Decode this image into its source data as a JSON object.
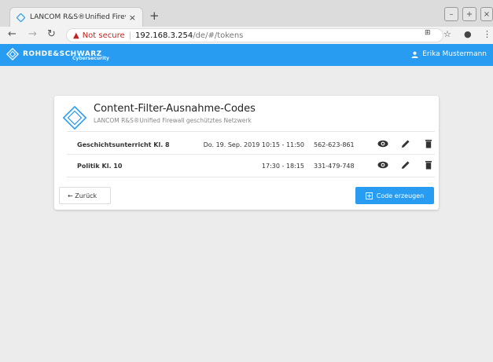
{
  "browser": {
    "tab_title": "LANCOM R&S®Unified Firewall",
    "tab_close": "×",
    "new_tab": "+",
    "security_label": "Not secure",
    "host": "192.168.3.254",
    "path": "/de/#/tokens"
  },
  "header": {
    "brand": "ROHDE&SCHWARZ",
    "brand_sub": "Cybersecurity",
    "user": "Erika Mustermann"
  },
  "card": {
    "title": "Content-Filter-Ausnahme-Codes",
    "subtitle": "LANCOM R&S®Unified Firewall geschütztes Netzwerk",
    "rows": [
      {
        "name": "Geschichtsunterricht Kl. 8",
        "time": "Do. 19. Sep. 2019 10:15 - 11:50",
        "code": "562-623-861"
      },
      {
        "name": "Politik Kl. 10",
        "time": "17:30 - 18:15",
        "code": "331-479-748"
      }
    ],
    "back_label": "← Zurück",
    "generate_label": "Code erzeugen"
  },
  "colors": {
    "accent": "#279cf1"
  }
}
